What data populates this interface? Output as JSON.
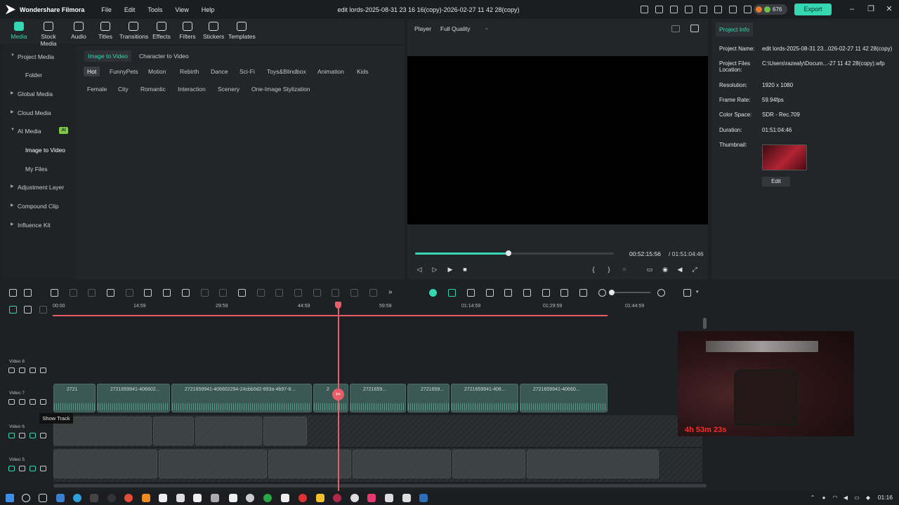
{
  "app": {
    "name": "Wondershare Filmora",
    "menu": [
      "File",
      "Edit",
      "Tools",
      "View",
      "Help"
    ],
    "doc_title": "edit lords-2025-08-31 23 16 16(copy)-2026-02-27 11 42 28(copy)",
    "credits": "676",
    "export_label": "Export"
  },
  "toolbar": {
    "items": [
      "Media",
      "Stock Media",
      "Audio",
      "Titles",
      "Transitions",
      "Effects",
      "Filters",
      "Stickers",
      "Templates"
    ],
    "active": "Media"
  },
  "sidebar": {
    "items": [
      {
        "label": "Project Media",
        "type": "group"
      },
      {
        "label": "Folder",
        "type": "sub"
      },
      {
        "label": "Global Media",
        "type": "group"
      },
      {
        "label": "Cloud Media",
        "type": "group"
      },
      {
        "label": "AI Media",
        "type": "group",
        "badge": "AI"
      },
      {
        "label": "Image to Video",
        "type": "sub",
        "active": true
      },
      {
        "label": "My Files",
        "type": "sub"
      },
      {
        "label": "Adjustment Layer",
        "type": "group"
      },
      {
        "label": "Compound Clip",
        "type": "group"
      },
      {
        "label": "Influence Kit",
        "type": "group"
      }
    ]
  },
  "media": {
    "tabs": [
      "Image to Video",
      "Character to Video"
    ],
    "categories_row1": [
      "Hot",
      "FunnyPets",
      "Motion",
      "Rebirth",
      "Dance",
      "Sci-Fi",
      "Toys&Blindbox",
      "Animation",
      "Kids"
    ],
    "categories_row2": [
      "Female",
      "City",
      "Romantic",
      "Interaction",
      "Scenery",
      "One-Image Stylization"
    ]
  },
  "player": {
    "label": "Player",
    "quality": "Full Quality",
    "current_time": "00:52:15:56",
    "total_time": "/ 01:51:04:46",
    "progress": 0.47
  },
  "project_info": {
    "tab": "Project Info",
    "rows": [
      {
        "label": "Project Name:",
        "value": "edit lords-2025-08-31 23...026-02-27 11 42 28(copy)"
      },
      {
        "label": "Project Files Location:",
        "value": "C:\\Users\\razealy\\Docum...-27 11 42 28(copy).wfp"
      },
      {
        "label": "Resolution:",
        "value": "1920 x 1080"
      },
      {
        "label": "Frame Rate:",
        "value": "59.94fps"
      },
      {
        "label": "Color Space:",
        "value": "SDR - Rec.709"
      },
      {
        "label": "Duration:",
        "value": "01:51:04:46"
      },
      {
        "label": "Thumbnail:",
        "value": ""
      }
    ],
    "edit_label": "Edit"
  },
  "timeline": {
    "ruler_labels": [
      "00:00",
      "14:59",
      "29:59",
      "44:59",
      "59:59",
      "01:14:59",
      "01:29:59",
      "01:44:59"
    ],
    "tracks": [
      "Video 8",
      "Video 7",
      "Video 6",
      "Video 5"
    ],
    "clip_labels": [
      "2721",
      "2721659941-406602...",
      "2721659941-406602294-24cbb0d2-893a-4b97-8...",
      "2",
      "2721659...",
      "2721659...",
      "2721659941-406...",
      "2721659941-40660..."
    ],
    "tooltip": "Show Track"
  },
  "overlay": {
    "timer": "4h 53m 23s"
  },
  "taskbar": {
    "time": "01:16"
  },
  "colors": {
    "accent": "#35d7b3",
    "playhead": "#e85d68",
    "background": "#1e2124"
  }
}
